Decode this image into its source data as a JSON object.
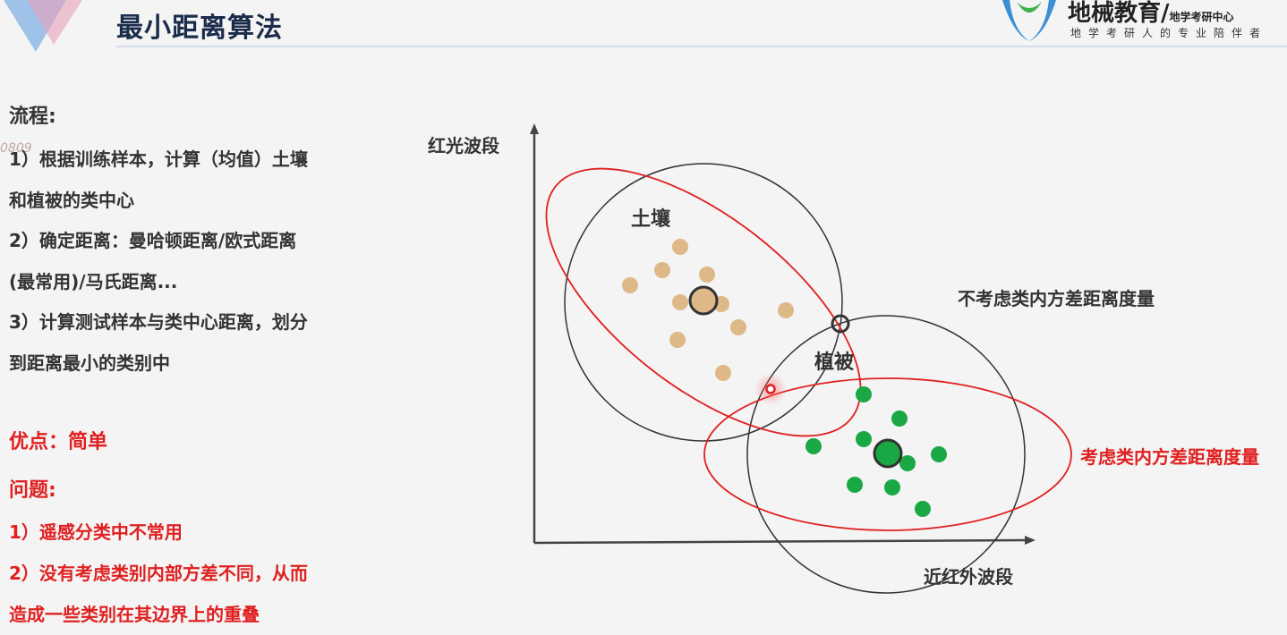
{
  "header": {
    "title": "最小距离算法",
    "brand_name": "地械教育",
    "brand_sub": "地学考研中心",
    "brand_slogan": "地学考研人的专业陪伴者",
    "watermark": "0809"
  },
  "process": {
    "heading": "流程:",
    "steps": [
      [
        "1）根据训练样本，计算（均值）土壤",
        "和植被的类中心"
      ],
      [
        "2）确定距离：曼哈顿距离/欧式距离",
        "(最常用)/马氏距离..."
      ],
      [
        "3）计算测试样本与类中心距离，划分",
        "到距离最小的类别中"
      ]
    ]
  },
  "advantage": "优点：简单",
  "problems": {
    "heading": "问题:",
    "items": [
      "1）遥感分类中不常用",
      "2）没有考虑类别内部方差不同，从而",
      "造成一些类别在其边界上的重叠"
    ]
  },
  "diagram": {
    "y_axis_label": "红光波段",
    "x_axis_label": "近红外波段",
    "class_soil": "土壤",
    "class_veg": "植被",
    "label_no_variance": "不考虑类内方差距离度量",
    "label_with_variance": "考虑类内方差距离度量",
    "colors": {
      "soil": "#deb887",
      "veg": "#1aa845",
      "red": "#e02020",
      "circle": "#333333"
    }
  }
}
